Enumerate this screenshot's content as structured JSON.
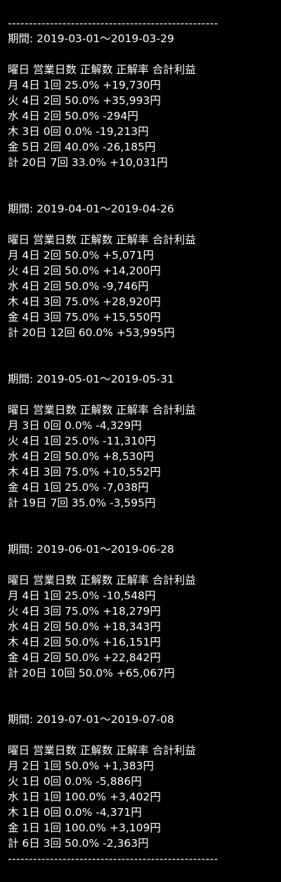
{
  "rule_text": "--------------------------------------------------",
  "header_labels": "曜日 営業日数 正解数 正解率 合計利益",
  "periods": [
    {
      "title": "期間: 2019-03-01～2019-03-29",
      "rows": [
        "月 4日 1回 25.0% +19,730円",
        "火 4日 2回 50.0% +35,993円",
        "水 4日 2回 50.0% -294円",
        "木 3日 0回 0.0% -19,213円",
        "金 5日 2回 40.0% -26,185円",
        "計 20日 7回 33.0% +10,031円"
      ]
    },
    {
      "title": "期間: 2019-04-01～2019-04-26",
      "rows": [
        "月 4日 2回 50.0% +5,071円",
        "火 4日 2回 50.0% +14,200円",
        "水 4日 2回 50.0% -9,746円",
        "木 4日 3回 75.0% +28,920円",
        "金 4日 3回 75.0% +15,550円",
        "計 20日 12回 60.0% +53,995円"
      ]
    },
    {
      "title": "期間: 2019-05-01～2019-05-31",
      "rows": [
        "月 3日 0回 0.0% -4,329円",
        "火 4日 1回 25.0% -11,310円",
        "水 4日 2回 50.0% +8,530円",
        "木 4日 3回 75.0% +10,552円",
        "金 4日 1回 25.0% -7,038円",
        "計 19日 7回 35.0% -3,595円"
      ]
    },
    {
      "title": "期間: 2019-06-01～2019-06-28",
      "rows": [
        "月 4日 1回 25.0% -10,548円",
        "火 4日 3回 75.0% +18,279円",
        "水 4日 2回 50.0% +18,343円",
        "木 4日 2回 50.0% +16,151円",
        "金 4日 2回 50.0% +22,842円",
        "計 20日 10回 50.0% +65,067円"
      ]
    },
    {
      "title": "期間: 2019-07-01～2019-07-08",
      "rows": [
        "月 2日 1回 50.0% +1,383円",
        "火 1日 0回 0.0% -5,886円",
        "水 1日 1回 100.0% +3,402円",
        "木 1日 0回 0.0% -4,371円",
        "金 1日 1回 100.0% +3,109円",
        "計 6日 3回 50.0% -2,363円"
      ]
    }
  ]
}
